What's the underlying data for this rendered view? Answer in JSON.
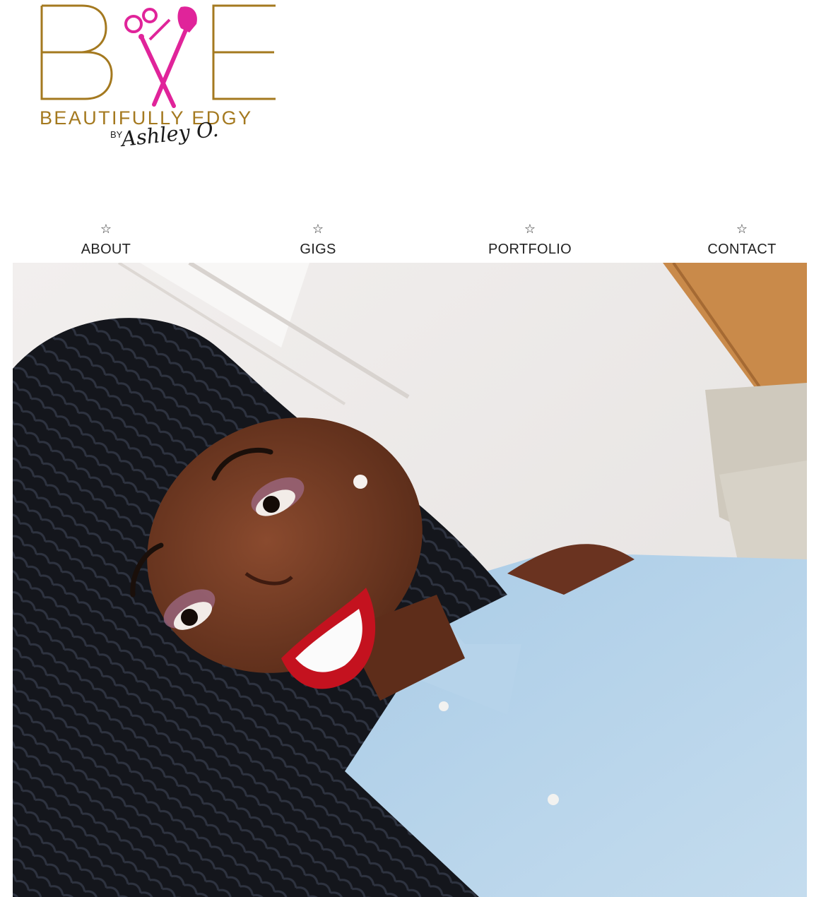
{
  "brand": {
    "monogram_left": "B",
    "monogram_right": "E",
    "tagline": "BEAUTIFULLY EDGY",
    "by": "BY",
    "signature": "Ashley O.",
    "colors": {
      "gold": "#a4791f",
      "magenta": "#e0249a"
    },
    "tools_icon": "scissors-and-brush-icon"
  },
  "nav": {
    "star_icon": "☆",
    "items": [
      {
        "label": "ABOUT"
      },
      {
        "label": "GIGS"
      },
      {
        "label": "PORTFOLIO"
      },
      {
        "label": "CONTACT"
      }
    ]
  },
  "hero": {
    "image": "portrait-photo"
  }
}
